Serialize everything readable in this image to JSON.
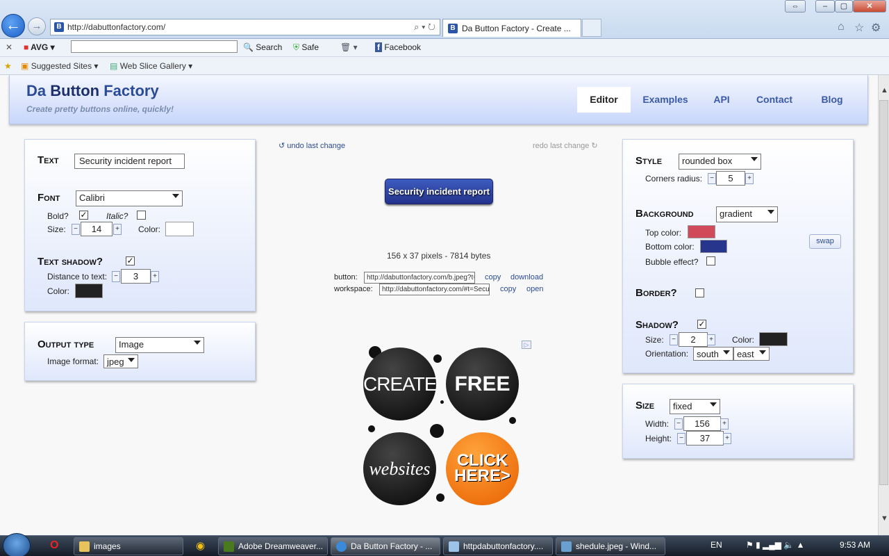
{
  "browser": {
    "url": "http://dabuttonfactory.com/",
    "tab_title": "Da Button Factory - Create ...",
    "commandbar": {
      "avg": "AVG",
      "search": "Search",
      "safe": "Safe",
      "facebook": "Facebook"
    },
    "favorites": {
      "suggested": "Suggested Sites",
      "webslice": "Web Slice Gallery"
    }
  },
  "header": {
    "logo_part1": "Da",
    "logo_part2": "Button",
    "logo_part3": "Factory",
    "tagline": "Create pretty buttons online, quickly!",
    "nav": [
      "Editor",
      "Examples",
      "API",
      "Contact",
      "Blog"
    ]
  },
  "text_panel": {
    "text_label": "Text",
    "text_value": "Security incident report",
    "font_label": "Font",
    "font_value": "Calibri",
    "bold_label": "Bold?",
    "bold_checked": true,
    "italic_label": "Italic?",
    "italic_checked": false,
    "size_label": "Size:",
    "size_value": "14",
    "color_label": "Color:",
    "color_value": "#ffffff",
    "shadow_label": "Text shadow?",
    "shadow_checked": true,
    "distance_label": "Distance to text:",
    "distance_value": "3",
    "shadow_color_label": "Color:",
    "shadow_color": "#222222"
  },
  "output_panel": {
    "label": "Output type",
    "type_value": "Image",
    "format_label": "Image format:",
    "format_value": "jpeg"
  },
  "center": {
    "undo": "undo last change",
    "redo": "redo last change",
    "button_text": "Security incident report",
    "info": "156 x 37 pixels - 7814 bytes",
    "button_url_label": "button:",
    "button_url": "http://dabuttonfactory.com/b.jpeg?t=",
    "copy1": "copy",
    "download": "download",
    "workspace_label": "workspace:",
    "workspace_url": "http://dabuttonfactory.com/#t=Secur",
    "copy2": "copy",
    "open": "open",
    "ad": {
      "create": "CREATE",
      "free": "FREE",
      "websites": "websites",
      "click": "CLICK",
      "here": "HERE>"
    }
  },
  "style_panel": {
    "style_label": "Style",
    "style_value": "rounded box",
    "corners_label": "Corners radius:",
    "corners_value": "5",
    "bg_label": "Background",
    "bg_value": "gradient",
    "top_color_label": "Top color:",
    "top_color": "#d04a5a",
    "bottom_color_label": "Bottom color:",
    "bottom_color": "#27358c",
    "swap": "swap",
    "bubble_label": "Bubble effect?",
    "bubble_checked": false,
    "border_label": "Border?",
    "border_checked": false,
    "shadow_label": "Shadow?",
    "shadow_checked": true,
    "shadow_size_label": "Size:",
    "shadow_size": "2",
    "shadow_color_label": "Color:",
    "shadow_color": "#222222",
    "orientation_label": "Orientation:",
    "orientation_v": "south",
    "orientation_h": "east"
  },
  "size_panel": {
    "label": "Size",
    "mode": "fixed",
    "width_label": "Width:",
    "width_value": "156",
    "height_label": "Height:",
    "height_value": "37"
  },
  "taskbar": {
    "items": [
      "images",
      "Adobe Dreamweaver...",
      "Da Button Factory - ...",
      "httpdabuttonfactory....",
      "shedule.jpeg - Wind..."
    ],
    "lang": "EN",
    "time": "9:53 AM"
  }
}
